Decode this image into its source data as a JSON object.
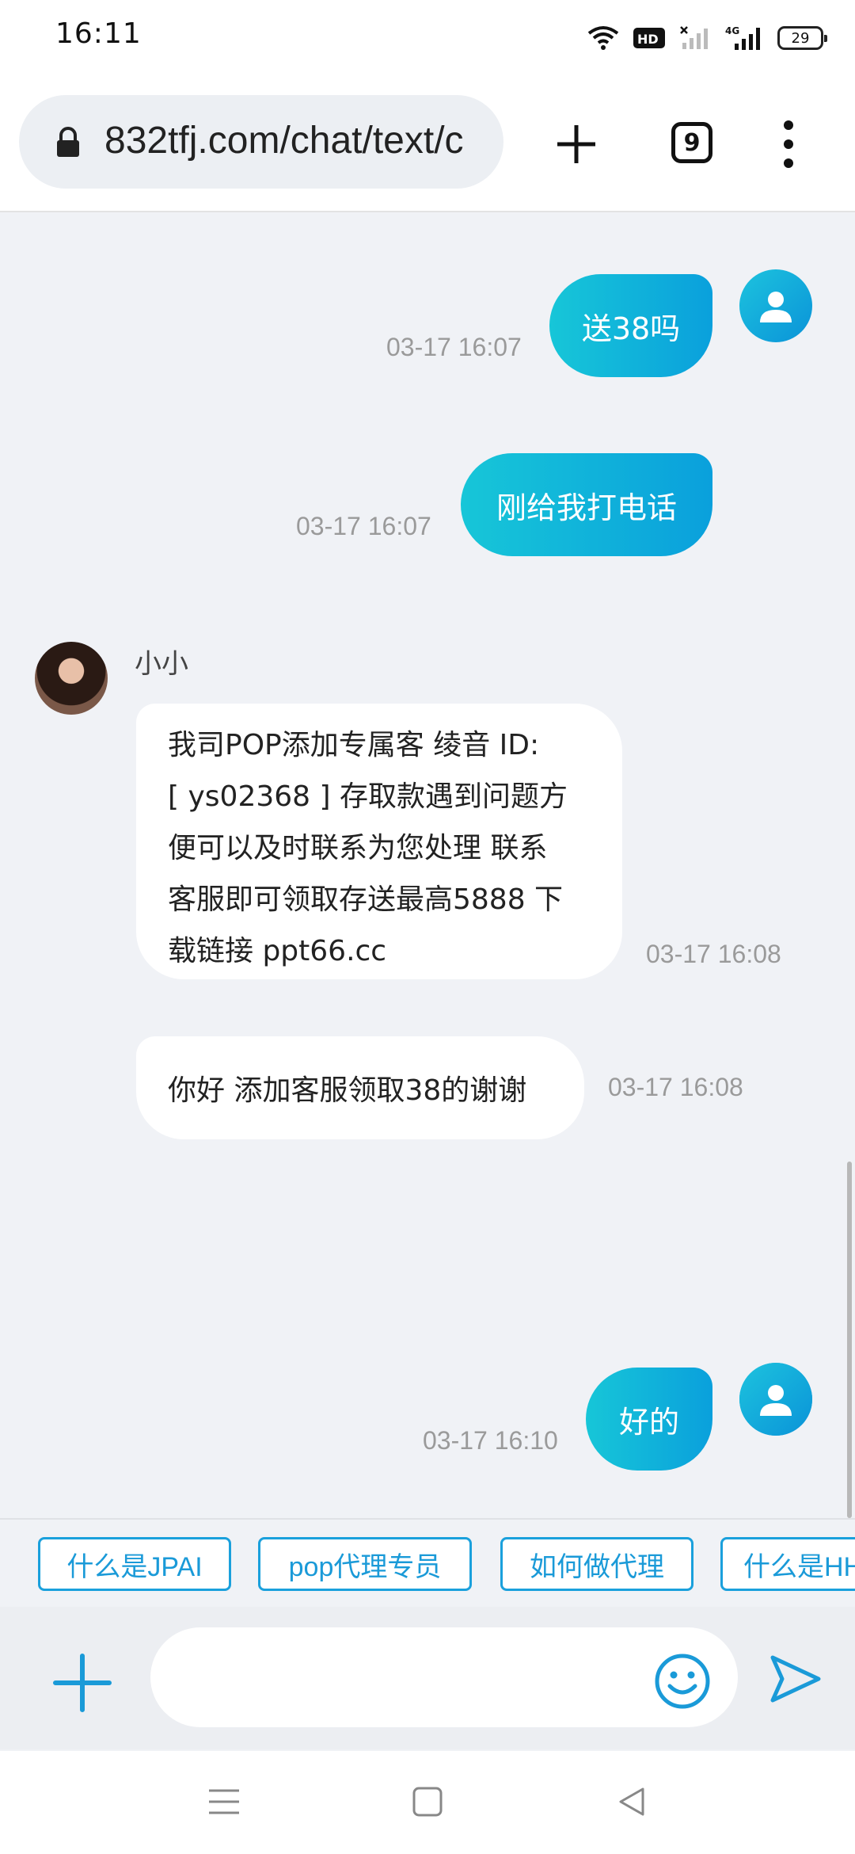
{
  "status_bar": {
    "time": "16:11",
    "icons": [
      "wifi-icon",
      "hd-icon",
      "signal-empty-icon",
      "signal-4g-icon",
      "battery-icon"
    ],
    "hd_label": "HD",
    "network_label": "4G",
    "battery_level": "29"
  },
  "browser": {
    "url": "832tfj.com/chat/text/c",
    "tab_count": "9"
  },
  "chat": {
    "messages": [
      {
        "sender": "user",
        "text": "送38吗",
        "time": "03-17 16:07"
      },
      {
        "sender": "user",
        "text": "刚给我打电话",
        "time": "03-17 16:07"
      },
      {
        "sender": "agent",
        "name": "小小",
        "lines": [
          "我司POP添加专属客 绫音 ID:",
          "[ ys02368 ] 存取款遇到问题方",
          "便可以及时联系为您处理 联系",
          "客服即可领取存送最高5888 下",
          "载链接 ppt66.cc"
        ],
        "time": "03-17 16:08"
      },
      {
        "sender": "agent",
        "text": "你好 添加客服领取38的谢谢",
        "time": "03-17 16:08"
      },
      {
        "sender": "user",
        "text": "好的",
        "time": "03-17 16:10"
      }
    ]
  },
  "quick_replies": [
    "什么是JPAI",
    "pop代理专员",
    "如何做代理",
    "什么是HH"
  ],
  "input": {
    "placeholder": ""
  },
  "colors": {
    "accent": "#0aa0dc",
    "accent_light": "#17c6d8",
    "chip": "#1a9ad8"
  }
}
